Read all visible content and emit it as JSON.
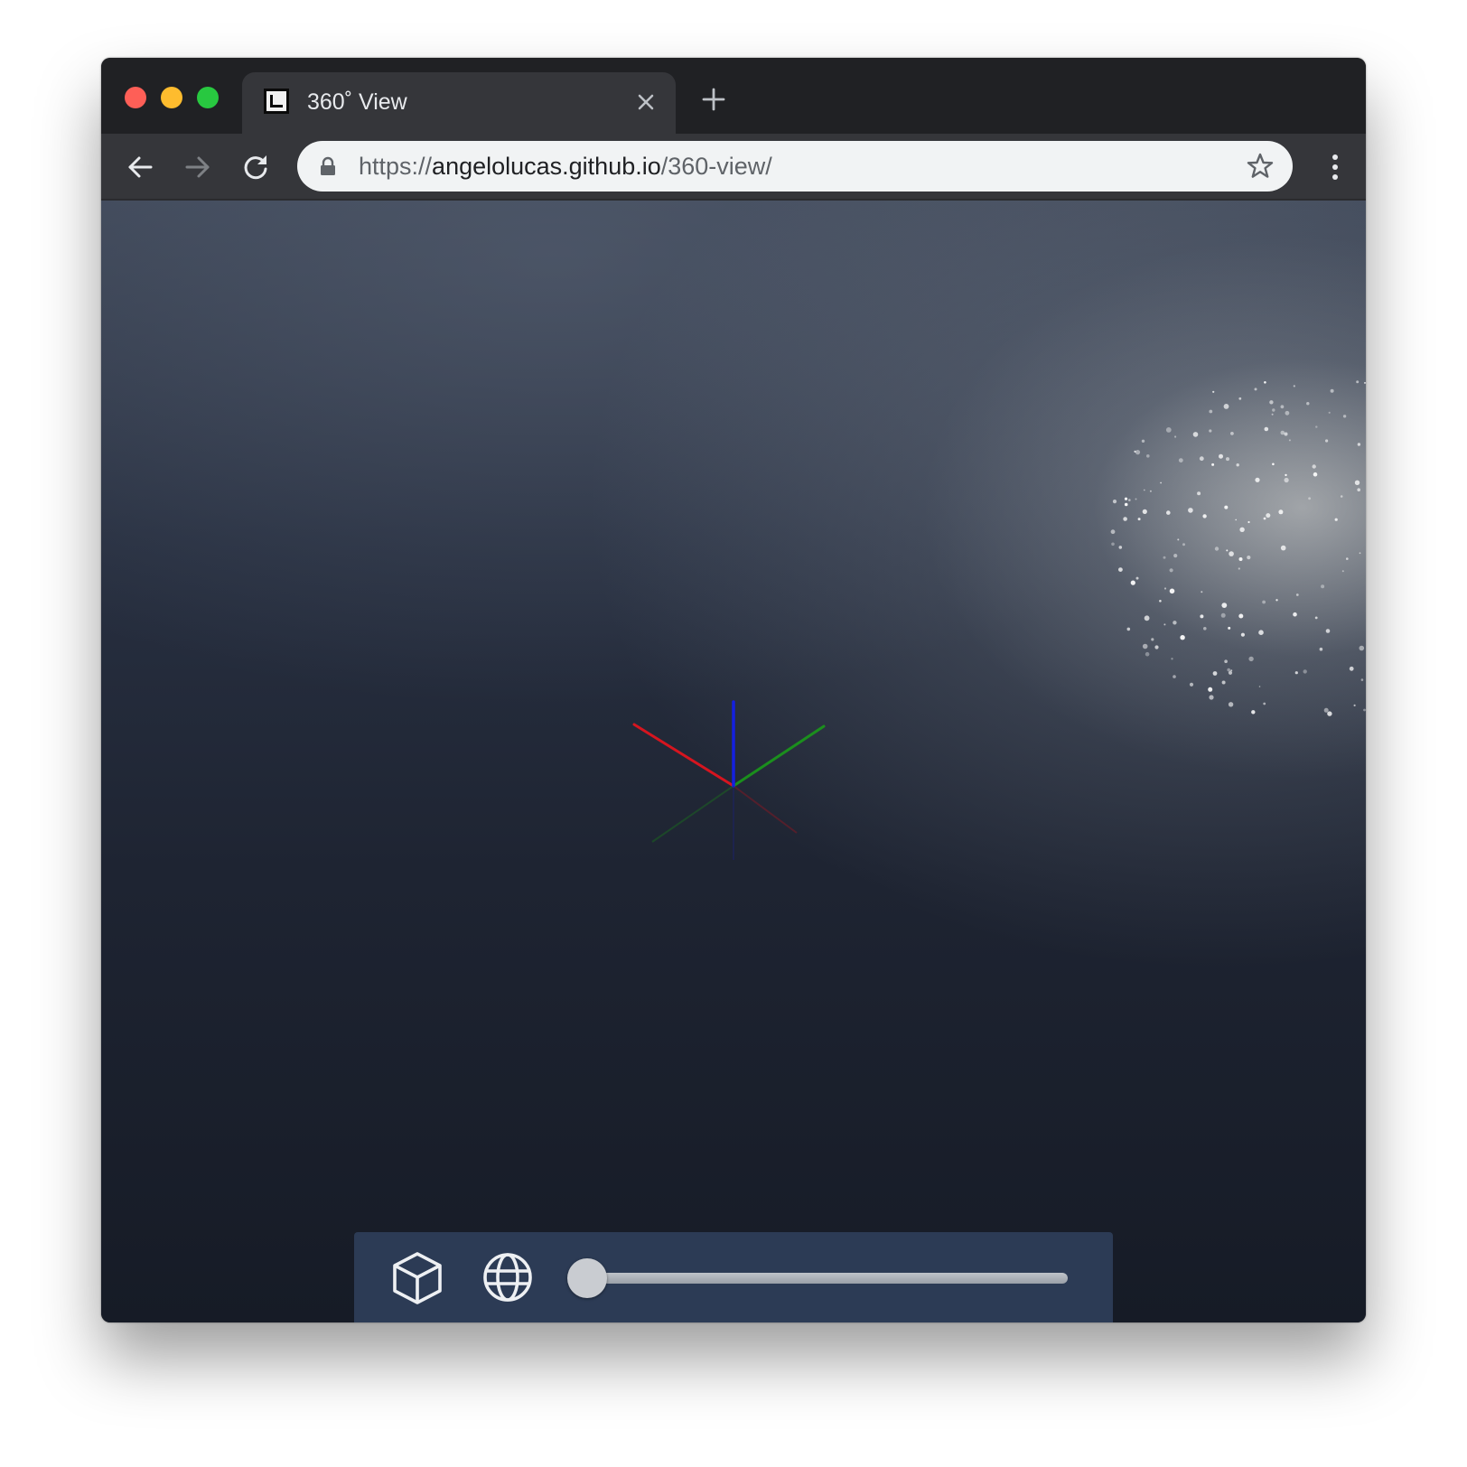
{
  "window": {
    "traffic_lights": [
      "close",
      "minimize",
      "maximize"
    ]
  },
  "tab": {
    "title": "360˚ View",
    "favicon": "L-logo-icon",
    "close_icon": "close-icon"
  },
  "new_tab_icon": "plus-icon",
  "toolbar": {
    "back_icon": "arrow-left-icon",
    "forward_icon": "arrow-right-icon",
    "reload_icon": "reload-icon",
    "lock_icon": "lock-icon",
    "url_scheme": "https://",
    "url_host": "angelolucas.github.io",
    "url_path": "/360-view/",
    "bookmark_icon": "star-icon",
    "menu_icon": "kebab-menu-icon"
  },
  "viewer": {
    "axes_colors": {
      "x": "#e0141e",
      "y": "#1a9a1a",
      "z": "#1420e0"
    }
  },
  "controls": {
    "cube_icon": "cube-icon",
    "globe_icon": "globe-icon",
    "slider_value": 0
  },
  "colors": {
    "titlebar": "#202124",
    "tab_active": "#35363a",
    "omnibox": "#f1f3f4",
    "control_bar": "#2c3b55"
  }
}
